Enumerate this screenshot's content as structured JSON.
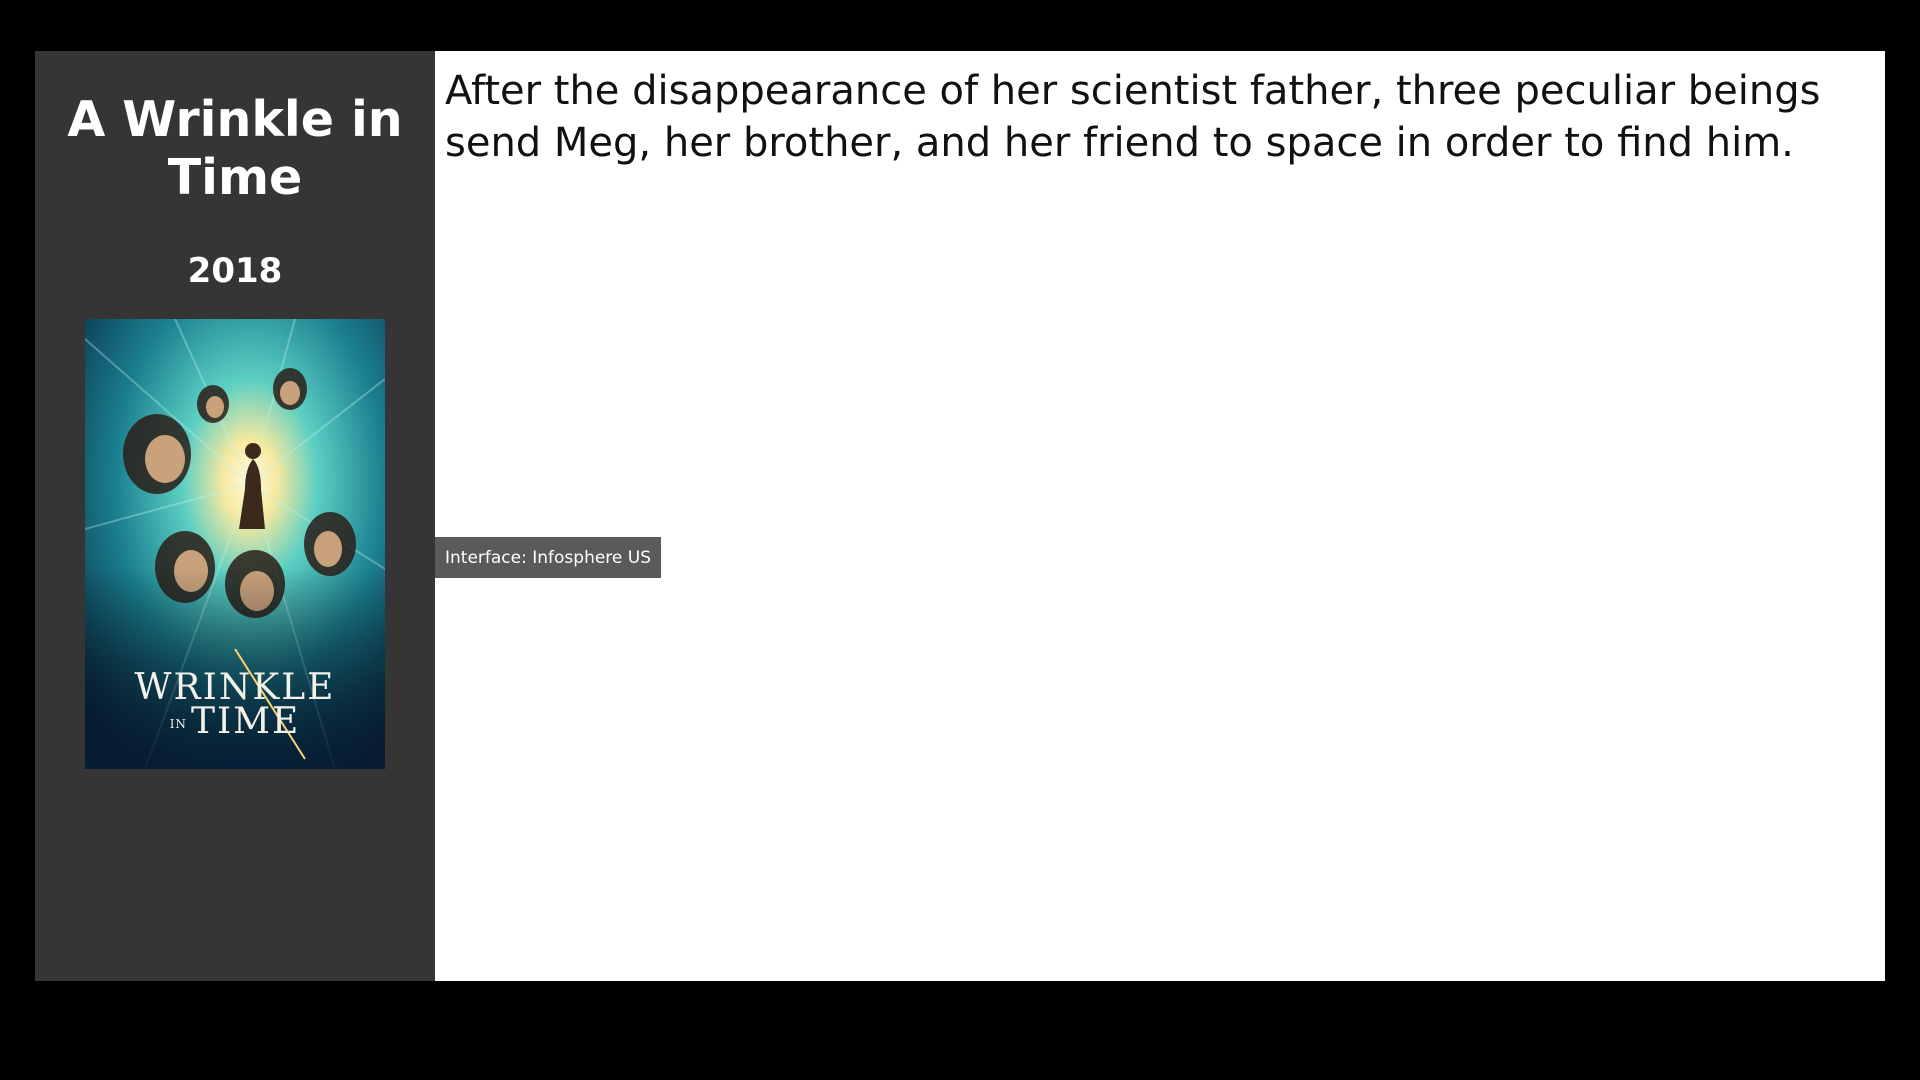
{
  "movie": {
    "title": "A Wrinkle in Time",
    "year": "2018",
    "synopsis": "After the disappearance of her scientist father, three peculiar beings send Meg, her brother, and her friend to space in order to find him.",
    "poster": {
      "logo_line1": "WRINKLE",
      "logo_in": "IN",
      "logo_line2": "TIME"
    }
  },
  "tooltip": {
    "text": "Interface: Infosphere US"
  },
  "colors": {
    "background": "#000000",
    "sidebar": "#353535",
    "content": "#ffffff",
    "tooltip": "#5a5a5a"
  }
}
